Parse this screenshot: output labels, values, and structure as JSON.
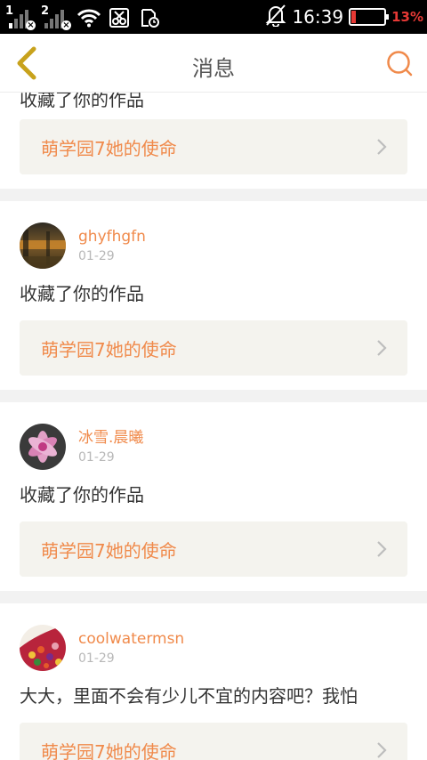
{
  "status_bar": {
    "sim1": "1",
    "sim2": "2",
    "time": "16:39",
    "battery_percent": "13%",
    "battery_level": 0.13,
    "icons": [
      "signal-icon",
      "signal-icon",
      "wifi-icon",
      "scissors-icon",
      "screenshot-icon",
      "mute-bell-icon",
      "battery-icon"
    ]
  },
  "header": {
    "title": "消息",
    "back_icon": "chevron-left-icon",
    "search_icon": "search-icon"
  },
  "colors": {
    "accent": "#f08a4b",
    "back": "#c8a21c",
    "card_bg": "#f4f3ee"
  },
  "messages": [
    {
      "content": "收藏了你的作品",
      "work_title": "萌学园7她的使命"
    },
    {
      "username": "ghyfhgfn",
      "date": "01-29",
      "content": "收藏了你的作品",
      "work_title": "萌学园7她的使命"
    },
    {
      "username": "冰雪.晨曦",
      "date": "01-29",
      "content": "收藏了你的作品",
      "work_title": "萌学园7她的使命"
    },
    {
      "username": "coolwatermsn",
      "date": "01-29",
      "content": "大大，里面不会有少儿不宜的内容吧？我怕",
      "work_title": "萌学园7她的使命"
    }
  ]
}
